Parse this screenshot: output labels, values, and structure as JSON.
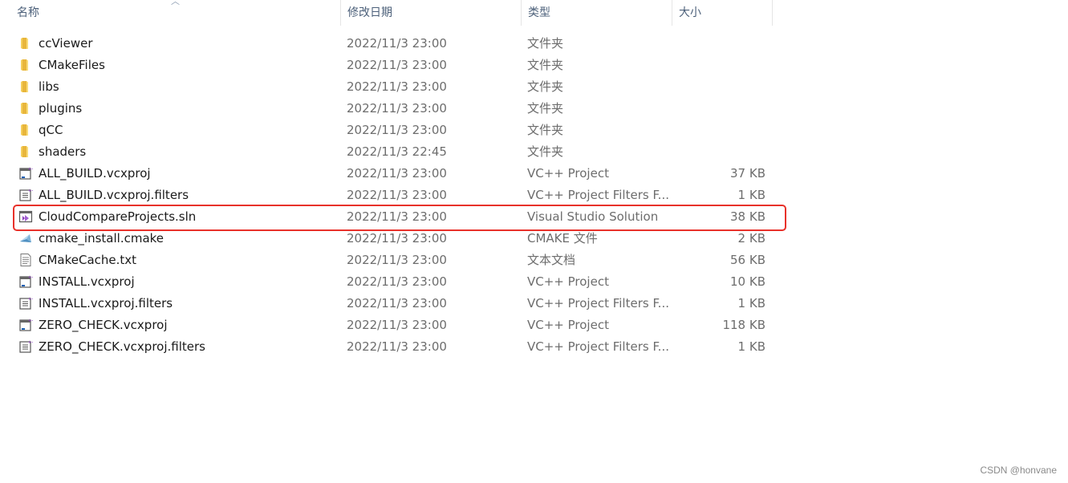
{
  "columns": {
    "name": "名称",
    "date": "修改日期",
    "type": "类型",
    "size": "大小"
  },
  "files": [
    {
      "name": "ccViewer",
      "date": "2022/11/3 23:00",
      "type": "文件夹",
      "size": "",
      "icon": "folder-icon"
    },
    {
      "name": "CMakeFiles",
      "date": "2022/11/3 23:00",
      "type": "文件夹",
      "size": "",
      "icon": "folder-icon"
    },
    {
      "name": "libs",
      "date": "2022/11/3 23:00",
      "type": "文件夹",
      "size": "",
      "icon": "folder-icon"
    },
    {
      "name": "plugins",
      "date": "2022/11/3 23:00",
      "type": "文件夹",
      "size": "",
      "icon": "folder-icon"
    },
    {
      "name": "qCC",
      "date": "2022/11/3 23:00",
      "type": "文件夹",
      "size": "",
      "icon": "folder-icon"
    },
    {
      "name": "shaders",
      "date": "2022/11/3 22:45",
      "type": "文件夹",
      "size": "",
      "icon": "folder-icon"
    },
    {
      "name": "ALL_BUILD.vcxproj",
      "date": "2022/11/3 23:00",
      "type": "VC++ Project",
      "size": "37 KB",
      "icon": "vcxproj-icon"
    },
    {
      "name": "ALL_BUILD.vcxproj.filters",
      "date": "2022/11/3 23:00",
      "type": "VC++ Project Filters F...",
      "size": "1 KB",
      "icon": "vcxproj-filters-icon"
    },
    {
      "name": "CloudCompareProjects.sln",
      "date": "2022/11/3 23:00",
      "type": "Visual Studio Solution",
      "size": "38 KB",
      "icon": "visual-studio-solution-icon"
    },
    {
      "name": "cmake_install.cmake",
      "date": "2022/11/3 23:00",
      "type": "CMAKE 文件",
      "size": "2 KB",
      "icon": "cmake-file-icon"
    },
    {
      "name": "CMakeCache.txt",
      "date": "2022/11/3 23:00",
      "type": "文本文档",
      "size": "56 KB",
      "icon": "text-document-icon"
    },
    {
      "name": "INSTALL.vcxproj",
      "date": "2022/11/3 23:00",
      "type": "VC++ Project",
      "size": "10 KB",
      "icon": "vcxproj-icon"
    },
    {
      "name": "INSTALL.vcxproj.filters",
      "date": "2022/11/3 23:00",
      "type": "VC++ Project Filters F...",
      "size": "1 KB",
      "icon": "vcxproj-filters-icon"
    },
    {
      "name": "ZERO_CHECK.vcxproj",
      "date": "2022/11/3 23:00",
      "type": "VC++ Project",
      "size": "118 KB",
      "icon": "vcxproj-icon"
    },
    {
      "name": "ZERO_CHECK.vcxproj.filters",
      "date": "2022/11/3 23:00",
      "type": "VC++ Project Filters F...",
      "size": "1 KB",
      "icon": "vcxproj-filters-icon"
    }
  ],
  "highlight_color": "#e8312a",
  "watermark": "CSDN @honvane"
}
